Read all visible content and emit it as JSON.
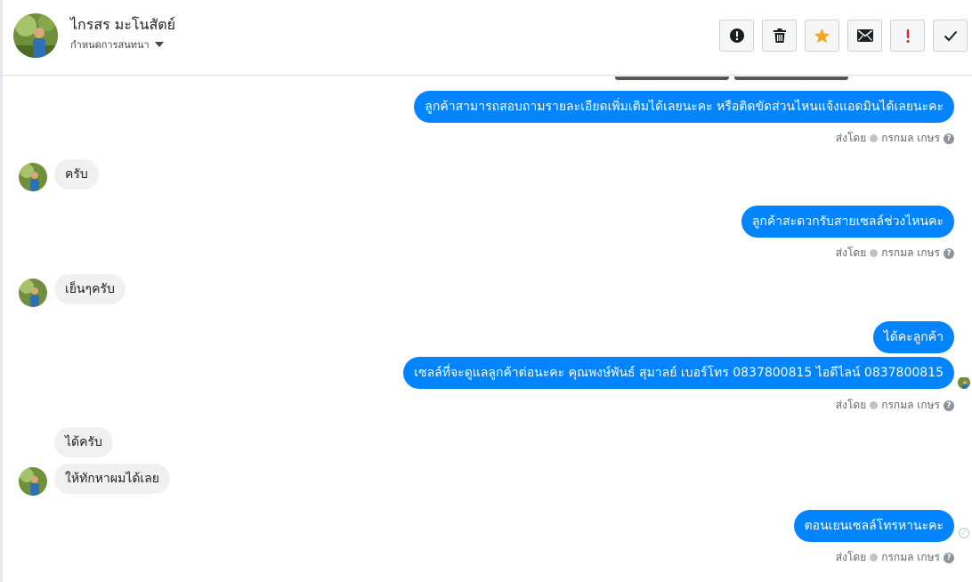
{
  "header": {
    "contact_name": "ไกรสร มะโนสัตย์",
    "subtitle": "กำหนดการสนทนา"
  },
  "actions": [
    {
      "name": "mark-spam-button",
      "icon": "alert-circle-icon"
    },
    {
      "name": "delete-button",
      "icon": "trash-icon"
    },
    {
      "name": "star-button",
      "icon": "star-icon"
    },
    {
      "name": "mark-unread-button",
      "icon": "envelope-icon"
    },
    {
      "name": "mark-important-button",
      "icon": "exclamation-icon"
    },
    {
      "name": "mark-done-button",
      "icon": "check-icon"
    }
  ],
  "messages": {
    "m1": "ลูกค้าสามารถสอบถามรายละเอียดเพิ่มเติมได้เลยนะคะ หรือติดขัดส่วนไหนแจ้งแอดมินได้เลยนะคะ",
    "m2": "ครับ",
    "m3": "ลูกค้าสะดวกรับสายเซลล์ช่วงไหนคะ",
    "m4": "เย็นๆครับ",
    "m5": "ได้คะลูกค้า",
    "m6": "เซลล์ที่จะดูแลลูกค้าต่อนะคะ  คุณพงษ์พันธ์ สุมาลย์     เบอร์โทร 0837800815  ไอดีไลน์ 0837800815",
    "m7": "ได้ครับ",
    "m8": "ให้ทักหาผมได้เลย",
    "m9": "ตอนเยนเซลล์โทรหานะคะ"
  },
  "sent_by": {
    "label": "ส่งโดย",
    "agent": "กรกมล เกษร"
  },
  "colors": {
    "outgoing_bubble": "#0084ff",
    "incoming_bubble": "#f1f0f0",
    "star": "#f5a623",
    "important": "#e02424"
  }
}
